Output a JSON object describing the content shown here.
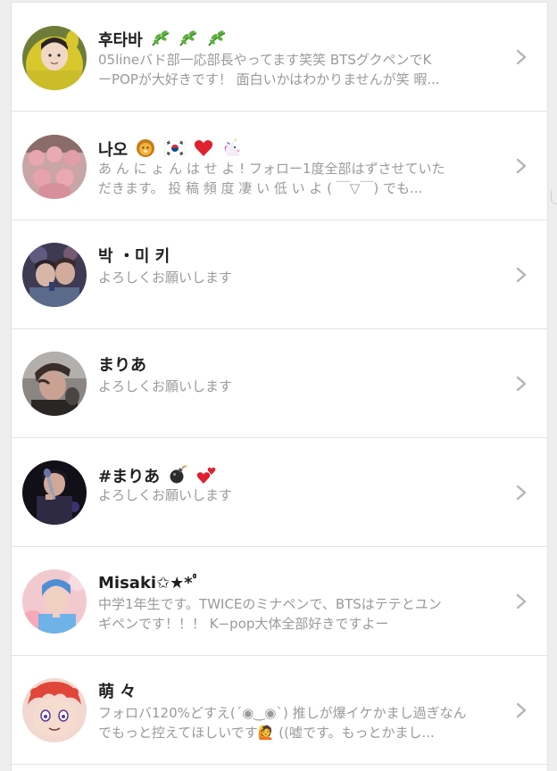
{
  "users": [
    {
      "name": "후타바",
      "bio": [
        "05lineバド部一応部長やってます笑笑 BTSグクペンでK",
        "ーPOPが大好きです！ 面白いかはわかりませんが笑 暇..."
      ],
      "icons": [
        "leaf-icon",
        "leaf-icon",
        "leaf-icon"
      ],
      "avatar_color": "#c8b82a"
    },
    {
      "name": "나오",
      "bio": [
        "あ ん に ょ ん は せ よ ! フォロー1度全部はずさせていた",
        "だきます。 投 稿 頻 度 凄 い 低 い よ ( ￣▽￣) でも..."
      ],
      "icons": [
        "lion-icon",
        "korea-flag-icon",
        "heart-icon",
        "unicorn-icon"
      ],
      "avatar_color": "#d9a7ad"
    },
    {
      "name": "박 ・미 키",
      "bio": [
        "よろしくお願いします"
      ],
      "icons": [],
      "avatar_color": "#57506a"
    },
    {
      "name": "まりあ",
      "bio": [
        "よろしくお願いします"
      ],
      "icons": [],
      "avatar_color": "#6e6a66"
    },
    {
      "name": "#まりあ",
      "bio": [
        "よろしくお願いします"
      ],
      "icons": [
        "bomb-icon",
        "two-hearts-icon"
      ],
      "avatar_color": "#15121c"
    },
    {
      "name": "Misaki✩★*ﾟ",
      "bio": [
        "中学1年生です。TWICEのミナペンで、BTSはテテとユン",
        "ギペンです！！！ K−pop大体全部好きですよー"
      ],
      "icons": [],
      "avatar_color": "#a9cbe6"
    },
    {
      "name": "萌 々",
      "bio": [
        "フォロバ120%どすえ(´◉‿◉`) 推しが爆イケかまし過ぎなん",
        "でもっと控えてほしいです🙋 ((嘘です。もっとかまし..."
      ],
      "icons": [],
      "avatar_color": "#e0463a"
    }
  ],
  "colors": {
    "name": "#1f1f1f",
    "bio": "#9a9a9a",
    "chevron": "#b5b5b5",
    "divider": "#e4e4e4",
    "background": "#eeeeee"
  }
}
